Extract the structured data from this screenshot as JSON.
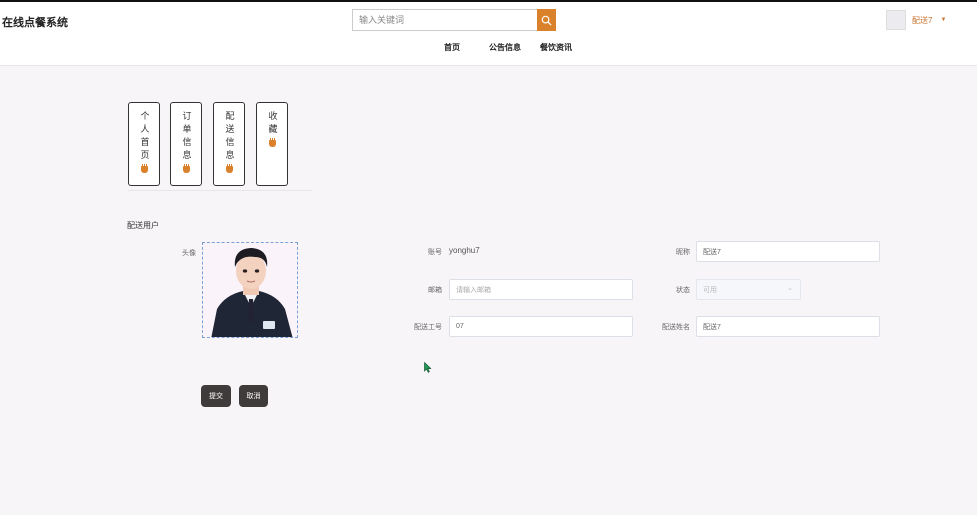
{
  "app": {
    "title": "在线点餐系统"
  },
  "search": {
    "placeholder": "输入关键词"
  },
  "user": {
    "name": "配送7"
  },
  "nav": {
    "items": [
      "首页",
      "公告信息",
      "餐饮资讯"
    ]
  },
  "side_tabs": [
    {
      "label": "个人首页"
    },
    {
      "label": "订单信息"
    },
    {
      "label": "配送信息"
    },
    {
      "label": "收藏"
    }
  ],
  "form": {
    "section_title": "配送用户",
    "avatar_label": "头像",
    "account_label": "账号",
    "account_value": "yonghu7",
    "nickname_label": "昵称",
    "nickname_value": "配送7",
    "email_label": "邮箱",
    "email_placeholder": "请输入邮箱",
    "status_label": "状态",
    "status_value": "可用",
    "staff_no_label": "配送工号",
    "staff_no_value": "07",
    "staff_name_label": "配送姓名",
    "staff_name_value": "配送7",
    "submit_label": "提交",
    "cancel_label": "取消"
  },
  "colors": {
    "accent": "#d9822b",
    "button": "#3f3b3b"
  }
}
